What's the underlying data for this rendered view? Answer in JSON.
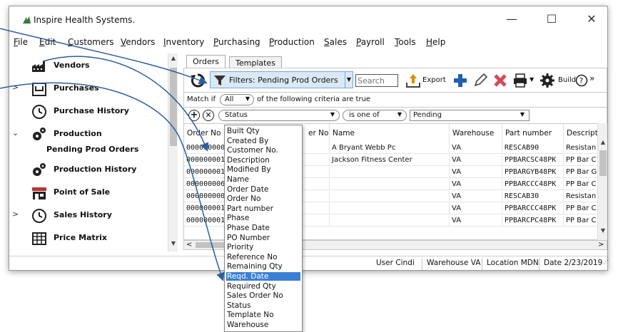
{
  "window": {
    "title": "Inspire Health Systems.",
    "minimize_icon": "—",
    "maximize_icon": "☐",
    "close_icon": "✕"
  },
  "menu": [
    "File",
    "Edit",
    "Customers",
    "Vendors",
    "Inventory",
    "Purchasing",
    "Production",
    "Sales",
    "Payroll",
    "Tools",
    "Help"
  ],
  "sidebar": {
    "items": [
      {
        "label": "Vendors"
      },
      {
        "label": "Purchases"
      },
      {
        "label": "Purchase History"
      },
      {
        "label": "Production",
        "caret": "✓"
      },
      {
        "label": "Pending Prod Orders"
      },
      {
        "label": "Production History"
      },
      {
        "label": "Point of Sale"
      },
      {
        "label": "Sales History",
        "caret": ">"
      },
      {
        "label": "Price Matrix"
      }
    ],
    "caret_purchases": ">"
  },
  "tabs": [
    "Orders",
    "Templates"
  ],
  "toolbar": {
    "filter_label": "Filters: Pending Prod Orders",
    "search_placeholder": "Search",
    "export_label": "Export",
    "build_label": "Build",
    "overflow": "»"
  },
  "match": {
    "prefix": "Match if",
    "mode": "All",
    "suffix": "of the following criteria are true"
  },
  "criteria": {
    "field": "Status",
    "operator": "is one of",
    "value": "Pending"
  },
  "grid": {
    "columns": [
      "Order No",
      "er No.",
      "Name",
      "Warehouse",
      "Part number",
      "Descript"
    ],
    "rows": [
      {
        "order": "0000000001",
        "name": "A Bryant Webb Pc",
        "warehouse": "VA",
        "part": "RESCAB90",
        "desc": "Resistan"
      },
      {
        "order": "0000000014",
        "name": "Jackson Fitness Center",
        "warehouse": "VA",
        "part": "PPBARCSC48PK",
        "desc": "PP Bar C"
      },
      {
        "order": "0000000017",
        "name": "",
        "warehouse": "VA",
        "part": "PPBARGYB48PK",
        "desc": "PP Bar G"
      },
      {
        "order": "0000000066",
        "name": "",
        "warehouse": "VA",
        "part": "PPBARCCC48PK",
        "desc": "PP Bar C"
      },
      {
        "order": "0000000004",
        "name": "",
        "warehouse": "VA",
        "part": "RESCAB30",
        "desc": "Resistan"
      },
      {
        "order": "0000000012",
        "name": "",
        "warehouse": "VA",
        "part": "PPBARCCC48PK",
        "desc": "PP Bar C"
      },
      {
        "order": "0000000013",
        "name": "",
        "warehouse": "VA",
        "part": "PPBARCPC48PK",
        "desc": "PP Bar C"
      }
    ]
  },
  "status": {
    "user": "User Cindi",
    "warehouse": "Warehouse VA",
    "location": "Location MDN",
    "date": "Date 2/23/2019"
  },
  "field_dropdown": {
    "selected": "Reqd. Date",
    "options": [
      "Built Qty",
      "Created By",
      "Customer No.",
      "Description",
      "Modified By",
      "Name",
      "Order Date",
      "Order No",
      "Part number",
      "Phase",
      "Phase Date",
      "PO Number",
      "Priority",
      "Reference No",
      "Remaining Qty",
      "Reqd. Date",
      "Required Qty",
      "Sales Order No",
      "Status",
      "Template No",
      "Warehouse"
    ]
  },
  "colors": {
    "accent": "#3a7fd6",
    "filter_bg": "#dbe8f6",
    "arrow": "#2c5f9e"
  }
}
